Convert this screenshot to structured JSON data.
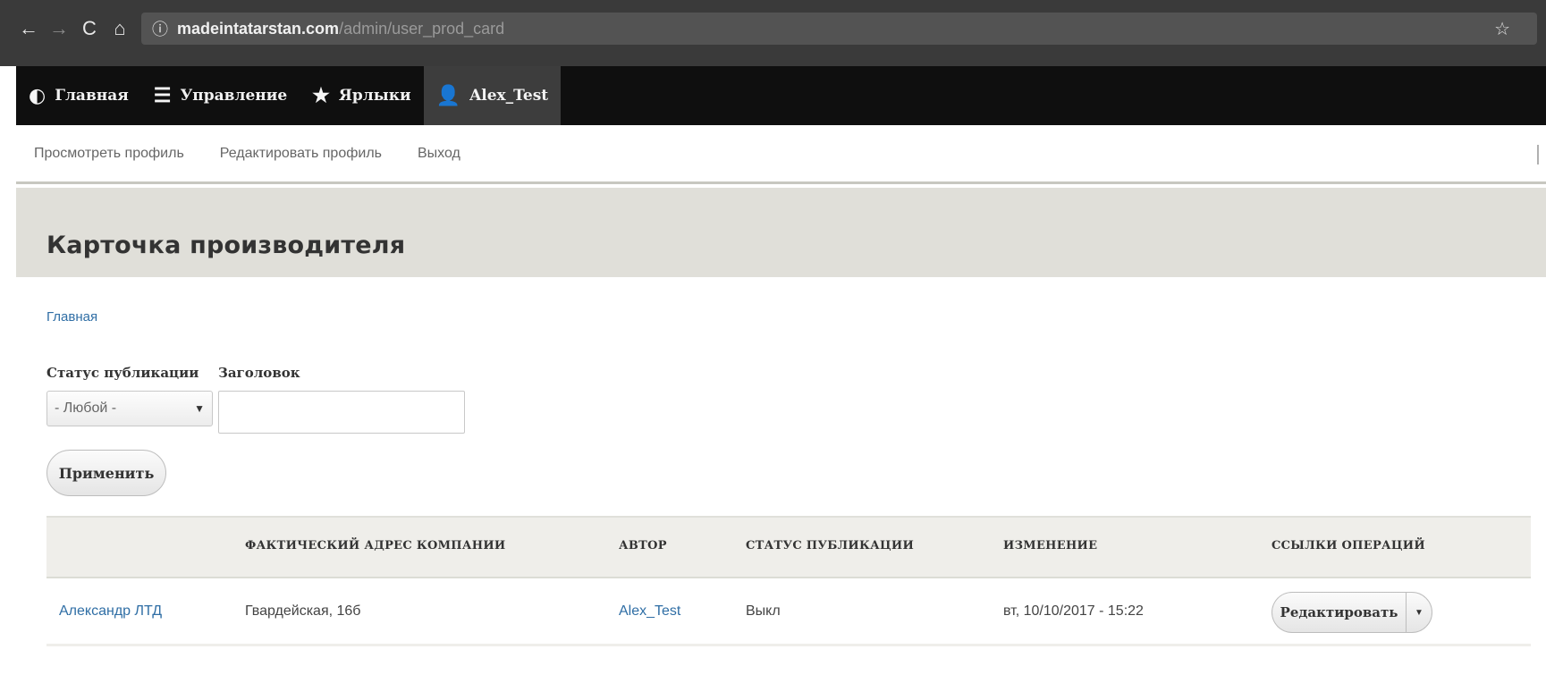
{
  "browser": {
    "back_icon": "←",
    "forward_icon": "→",
    "reload_icon": "C",
    "home_icon": "⌂",
    "info_icon": "ⓘ",
    "url_host": "madeintatarstan.com",
    "url_path": "/admin/user_prod_card",
    "star_icon": "☆",
    "menu_icon": "⋮"
  },
  "toolbar": {
    "items": [
      {
        "icon": "◐",
        "label": "Главная"
      },
      {
        "icon": "☰",
        "label": "Управление"
      },
      {
        "icon": "★",
        "label": "Ярлыки"
      },
      {
        "icon": "👤",
        "label": "Alex_Test"
      }
    ]
  },
  "tray": {
    "links": [
      "Просмотреть профиль",
      "Редактировать профиль",
      "Выход"
    ]
  },
  "page": {
    "title": "Карточка производителя",
    "breadcrumb": "Главная"
  },
  "filters": {
    "status_label": "Статус публикации",
    "status_value": "- Любой -",
    "status_arrow": "▼",
    "title_label": "Заголовок",
    "title_value": "",
    "apply_label": "Применить"
  },
  "table": {
    "headers": [
      "",
      "ФАКТИЧЕСКИЙ АДРЕС КОМПАНИИ",
      "АВТОР",
      "СТАТУС ПУБЛИКАЦИИ",
      "ИЗМЕНЕНИЕ",
      "ССЫЛКИ ОПЕРАЦИЙ"
    ],
    "rows": [
      {
        "name": "Александр ЛТД",
        "address": "Гвардейская, 16б",
        "author": "Alex_Test",
        "status": "Выкл",
        "changed": "вт, 10/10/2017 - 15:22",
        "edit_label": "Редактировать",
        "dropdown_icon": "▼"
      }
    ]
  },
  "colors": {
    "toolbar_bg": "#0f0f0f",
    "header_bg": "#e0dfd9",
    "link": "#2f6ea5"
  }
}
